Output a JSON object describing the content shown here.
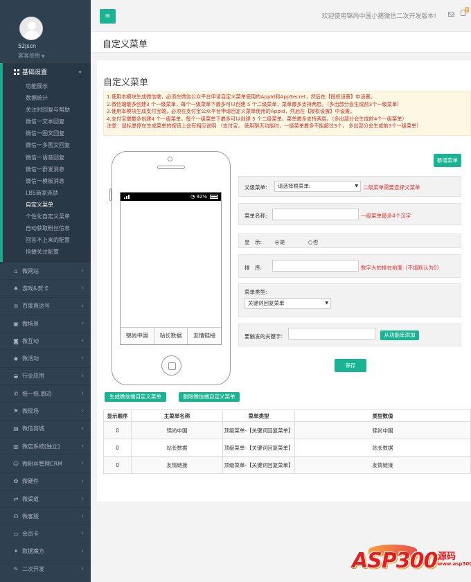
{
  "sidebar": {
    "profile": {
      "name": "52jscn",
      "role": "客客使用"
    },
    "active_group": {
      "label": "基础设置",
      "items": [
        "功能展示",
        "数据统计",
        "关注时回复与帮助",
        "微信一文本回复",
        "微信一图文回复",
        "微信一多图文回复",
        "微信一语音回复",
        "微信一群发消息",
        "微信一模板消息",
        "LBS商家连锁",
        "自定义菜单",
        "个性化自定义菜单",
        "自动获取粉丝信息",
        "回答不上来的配置",
        "快捷关注配置"
      ],
      "active_index": 10
    },
    "nav": [
      {
        "icon": "home-icon",
        "glyph": "⌂",
        "label": "微网站"
      },
      {
        "icon": "gamepad-icon",
        "glyph": "♠",
        "label": "游戏&贺卡"
      },
      {
        "icon": "globe-icon",
        "glyph": "◎",
        "label": "百度直达号"
      },
      {
        "icon": "image-icon",
        "glyph": "▣",
        "label": "微场景"
      },
      {
        "icon": "camera-icon",
        "glyph": "◙",
        "label": "微互动"
      },
      {
        "icon": "gift-icon",
        "glyph": "◆",
        "label": "微活动"
      },
      {
        "icon": "car-icon",
        "glyph": "◒",
        "label": "行业应用"
      },
      {
        "icon": "phone-icon",
        "glyph": "✆",
        "label": "摇一摇,周边"
      },
      {
        "icon": "flag-icon",
        "glyph": "⚑",
        "label": "微现场"
      },
      {
        "icon": "shop-icon",
        "glyph": "▤",
        "label": "微信商城"
      },
      {
        "icon": "store-icon",
        "glyph": "▥",
        "label": "微店系统[独立]"
      },
      {
        "icon": "users-icon",
        "glyph": "☺",
        "label": "微粉丝管理CRM"
      },
      {
        "icon": "plugin-icon",
        "glyph": "✿",
        "label": "微硬件"
      },
      {
        "icon": "shuffle-icon",
        "glyph": "⇄",
        "label": "微渠道"
      },
      {
        "icon": "headset-icon",
        "glyph": "☊",
        "label": "微客服"
      },
      {
        "icon": "card-icon",
        "glyph": "▭",
        "label": "会员卡"
      },
      {
        "icon": "magic-icon",
        "glyph": "✦",
        "label": "数据魔方"
      },
      {
        "icon": "wrench-icon",
        "glyph": "✎",
        "label": "二次开发"
      }
    ]
  },
  "topbar": {
    "menu_glyph": "≡",
    "welcome": "欢迎使用锦尚中国小猪微信二次开发版本!",
    "badge": "8"
  },
  "page": {
    "breadcrumb_title": "自定义菜单",
    "section_title": "自定义菜单",
    "notice_lines": [
      "1.使用本模块生成微信端，必须在微信公众平台申请自定义菜单使用的AppId和AppSecret，然后在【授权设置】中设置。",
      "2.微信端最多创建3 个一级菜单，每个一级菜单下最多可以创建 5 个二级菜单，菜单最多支持两层。（多出部分会生成前3个一级菜单）",
      "3.使用本模块生成支付宝端，必须在支付宝公众平台申请自定义菜单使用的AppId，然后在【授权设置】中设置。",
      "4.支付宝端最多创建4 个一级菜单，每个一级菜单下最多可以创建 5 个二级菜单，菜单最多支持两层。（多出部分会生成前4个一级菜单）",
      "注意：鼠标悬停在生成菜单的按钮上会有相应说明 （支付宝， 使用聊天功能时，一级菜单最多不能超过3个， 多出部分会生成前3个一级菜单）"
    ]
  },
  "phone": {
    "battery_text": "92%",
    "menu": [
      "锦尚中国",
      "站长数据",
      "友情链接"
    ]
  },
  "form": {
    "new_menu_button": "新增菜单",
    "parent": {
      "label": "父级菜单:",
      "value": "请选择根菜单:",
      "hint": "二级菜单需要选择父菜单"
    },
    "name": {
      "label": "菜单名称:",
      "value": "",
      "hint": "一级菜单最多4个汉字"
    },
    "display": {
      "label": "显　示:",
      "yes": "是",
      "no": "否",
      "selected": "是"
    },
    "order": {
      "label": "排　序:",
      "value": "",
      "hint": "数字大的排在前面（不填默认为0）"
    },
    "type": {
      "label": "菜单类型:",
      "value": "关键词回复菜单"
    },
    "keyword": {
      "label": "要触发的关键字:",
      "value": "",
      "button": "从功能库添加"
    },
    "save_button": "保存",
    "gen_button": "生成微信端自定义菜单",
    "del_button": "删除微信端自定义菜单"
  },
  "table": {
    "headers": [
      "显示顺序",
      "主菜单名称",
      "菜单类型",
      "类型数值"
    ],
    "rows": [
      [
        "0",
        "锦尚中国",
        "顶级菜单-【关键词回复菜单】",
        "锦尚中国"
      ],
      [
        "0",
        "站长数据",
        "顶级菜单-【关键词回复菜单】",
        "站长数据"
      ],
      [
        "0",
        "友情链接",
        "顶级菜单-【关键词回复菜单】",
        "友情链接"
      ]
    ]
  },
  "watermark": {
    "main": "ASP300",
    "side": "源码",
    "url": "www.asp300.com"
  }
}
